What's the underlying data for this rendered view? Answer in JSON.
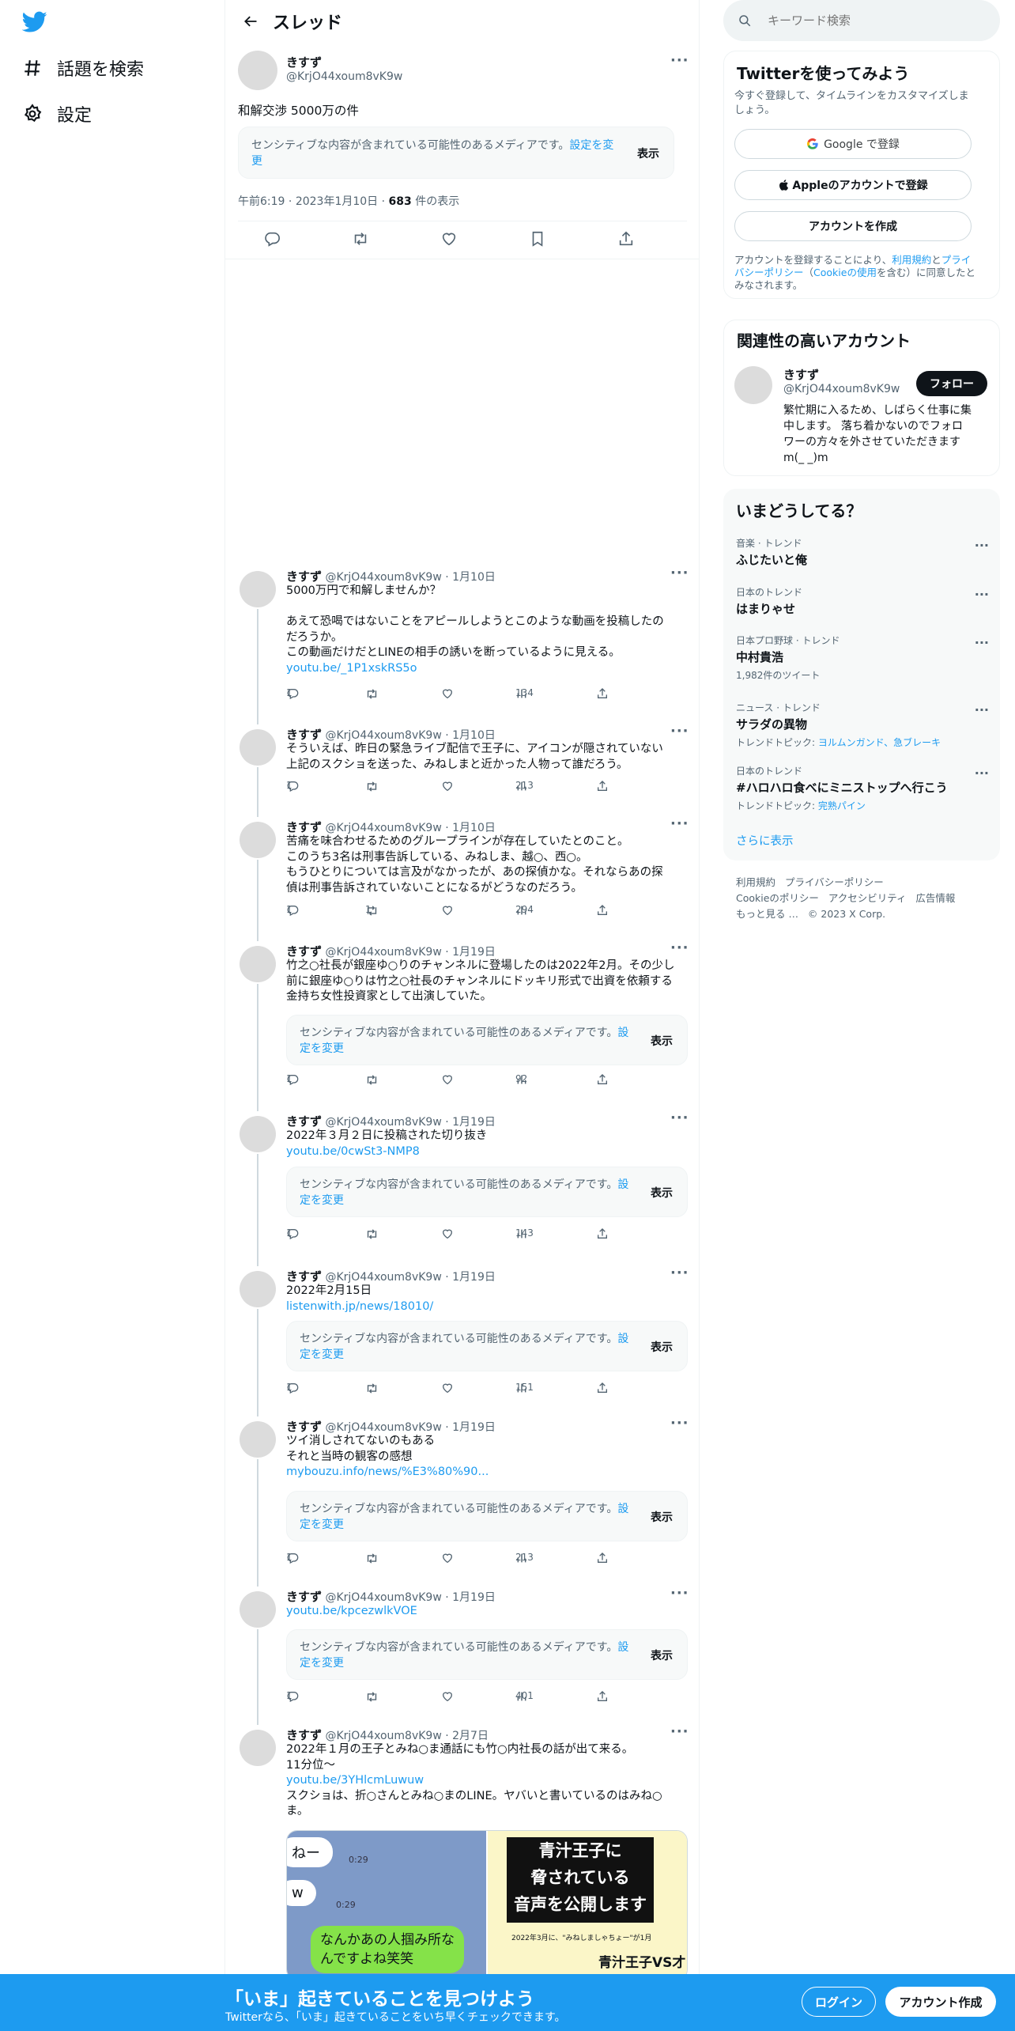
{
  "nav": {
    "explore": "話題を検索",
    "settings": "設定"
  },
  "header": {
    "title": "スレッド"
  },
  "main_tweet": {
    "name": "きすず",
    "handle": "@KrjO44xoum8vK9w",
    "text": "和解交渉 5000万の件",
    "sensitive_text": "センシティブな内容が含まれている可能性のあるメディアです。",
    "sensitive_link": "設定を変更",
    "sensitive_btn": "表示",
    "time": "午前6:19",
    "date": "2023年1月10日",
    "views_count": "683",
    "views_label": "件の表示"
  },
  "tweets": [
    {
      "name": "きすず",
      "meta": "@KrjO44xoum8vK9w · 1月10日",
      "lines": [
        "5000万円で和解しませんか？",
        "",
        "あえて恐喝ではないことをアピールしようとこのような動画を投稿したの",
        "だろうか。",
        "この動画だけだとLINEの相手の誘いを断っているように見える。"
      ],
      "link": "youtu.be/_1P1xskRS5o",
      "replies": "1",
      "retweets": "",
      "views": "134"
    },
    {
      "name": "きすず",
      "meta": "@KrjO44xoum8vK9w · 1月10日",
      "lines": [
        "そういえば、昨日の緊急ライブ配信で王子に、アイコンが隠されていない",
        "上記のスクショを送った、みねしまと近かった人物って誰だろう。"
      ],
      "link": "",
      "replies": "1",
      "retweets": "",
      "views": "213"
    },
    {
      "name": "きすず",
      "meta": "@KrjO44xoum8vK9w · 1月10日",
      "lines": [
        "苦痛を味合わせるためのグループラインが存在していたとのこと。",
        "このうち3名は刑事告訴している、みねしま、越○、西○。",
        "もうひとりについては言及がなかったが、あの探偵かな。それならあの探",
        "偵は刑事告訴されていないことになるがどうなのだろう。"
      ],
      "link": "",
      "replies": "1",
      "retweets": "1",
      "views": "294"
    },
    {
      "name": "きすず",
      "meta": "@KrjO44xoum8vK9w · 1月19日",
      "lines": [
        "竹之○社長が銀座ゆ○りのチャンネルに登場したのは2022年2月。その少し",
        "前に銀座ゆ○りは竹之○社長のチャンネルにドッキリ形式で出資を依頼する",
        "金持ち女性投資家として出演していた。"
      ],
      "link": "",
      "replies": "1",
      "retweets": "",
      "views": "92"
    },
    {
      "name": "きすず",
      "meta": "@KrjO44xoum8vK9w · 1月19日",
      "lines": [
        "2022年３月２日に投稿された切り抜き"
      ],
      "link": "youtu.be/0cwSt3-NMP8",
      "replies": "1",
      "retweets": "",
      "views": "143"
    },
    {
      "name": "きすず",
      "meta": "@KrjO44xoum8vK9w · 1月19日",
      "lines": [
        "2022年2月15日"
      ],
      "link": "listenwith.jp/news/18010/",
      "replies": "1",
      "retweets": "",
      "views": "151"
    },
    {
      "name": "きすず",
      "meta": "@KrjO44xoum8vK9w · 1月19日",
      "lines": [
        "ツイ消しされてないのもある",
        "それと当時の観客の感想"
      ],
      "link": "mybouzu.info/news/%E3%80%90...",
      "replies": "1",
      "retweets": "",
      "views": "213"
    },
    {
      "name": "きすず",
      "meta": "@KrjO44xoum8vK9w · 1月19日",
      "lines": [],
      "link": "youtu.be/kpcezwlkVOE",
      "replies": "1",
      "retweets": "",
      "views": "401"
    },
    {
      "name": "きすず",
      "meta": "@KrjO44xoum8vK9w · 2月7日",
      "lines": [
        "2022年１月の王子とみね○ま通話にも竹○内社長の話が出て来る。",
        "11分位〜"
      ],
      "link": "youtu.be/3YHlcmLuwuw",
      "lines2": [
        "スクショは、折○さんとみね○まのLINE。ヤバいと書いているのはみね○",
        "ま。"
      ],
      "replies": "",
      "retweets": "",
      "views": ""
    }
  ],
  "media_thumb": {
    "chat": [
      "ねー",
      "0:29",
      "w",
      "0:29",
      "なんかあの人掴み所な",
      "んですよね笑笑"
    ],
    "video_title": [
      "青汁王子に",
      "脅されている",
      "音声を公開します"
    ],
    "video_caption": "2022年3月に、\"みねしましゃちょー\"が1月",
    "video_sub": "青汁王子VS才"
  },
  "right": {
    "search_placeholder": "キーワード検索",
    "signup_title": "Twitterを使ってみよう",
    "signup_desc": [
      "今すぐ登録して、タイムラインをカスタマイズしま",
      "しょう。"
    ],
    "google_btn": "Google で登録",
    "apple_btn": "Appleのアカウントで登録",
    "create_btn": "アカウントを作成",
    "terms": [
      "アカウントを登録することにより、",
      "利用規約",
      "と",
      "プライ",
      "バシーポリシー",
      "（",
      "Cookieの使用",
      "を含む）に同意したと",
      "みなされます。"
    ],
    "related_title": "関連性の高いアカウント",
    "related_name": "きすず",
    "related_handle": "@KrjO44xoum8vK9w",
    "follow_btn": "フォロー",
    "related_bio": [
      "繁忙期に入るため、しばらく仕事に集",
      "中します。 落ち着かないのでフォロ",
      "ワーの方々を外させていただきます",
      "m(_ _)m"
    ],
    "trends_title": "いまどうしてる？",
    "trends": [
      {
        "cat": "音楽 · トレンド",
        "name": "ふじたいと俺",
        "sub": "",
        "topics": ""
      },
      {
        "cat": "日本のトレンド",
        "name": "はまりゃせ",
        "sub": "",
        "topics": ""
      },
      {
        "cat": "日本プロ野球 · トレンド",
        "name": "中村貴浩",
        "sub": "1,982件のツイート",
        "topics": ""
      },
      {
        "cat": "ニュース · トレンド",
        "name": "サラダの異物",
        "sub": "トレンドトピック: ",
        "topics": "ヨルムンガンド、急ブレーキ"
      },
      {
        "cat": "日本のトレンド",
        "name": "#ハロハロ食べにミニストップへ行こう",
        "sub": "トレンドトピック: ",
        "topics": "完熟パイン"
      }
    ],
    "show_more": "さらに表示",
    "footer": [
      "利用規約",
      "プライバシーポリシー",
      "Cookieのポリシー",
      "アクセシビリティ",
      "広告情報",
      "もっと見る …",
      "© 2023 X Corp."
    ]
  },
  "bottom": {
    "title": "「いま」起きていることを見つけよう",
    "subtitle": "Twitterなら、「いま」起きていることをいち早くチェックできます。",
    "login": "ログイン",
    "signup": "アカウント作成"
  },
  "colors": {
    "accent": "#1d9bf0",
    "text": "#0f1419",
    "secondary": "#536471"
  }
}
